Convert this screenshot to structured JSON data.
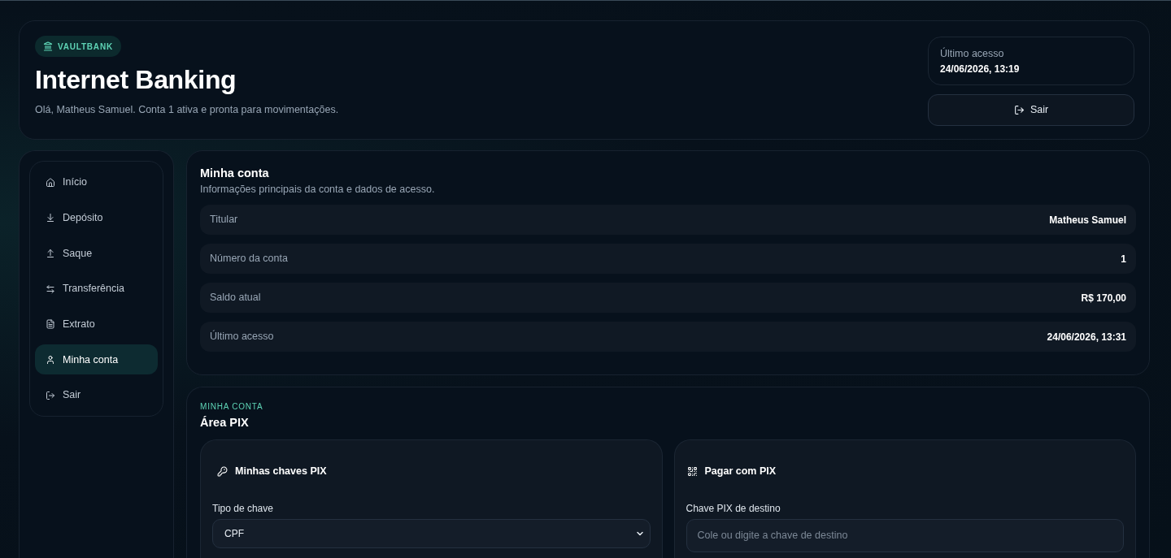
{
  "header": {
    "brand": "VAULTBANK",
    "title": "Internet Banking",
    "greeting": "Olá, Matheus Samuel. Conta 1 ativa e pronta para movimentações.",
    "last_access": {
      "label": "Último acesso",
      "value": "24/06/2026, 13:19"
    },
    "logout_button": "Sair"
  },
  "sidebar": {
    "items": [
      {
        "label": "Início",
        "selected": false
      },
      {
        "label": "Depósito",
        "selected": false
      },
      {
        "label": "Saque",
        "selected": false
      },
      {
        "label": "Transferência",
        "selected": false
      },
      {
        "label": "Extrato",
        "selected": false
      },
      {
        "label": "Minha conta",
        "selected": true
      },
      {
        "label": "Sair",
        "selected": false
      }
    ]
  },
  "account": {
    "title": "Minha conta",
    "subtitle": "Informações principais da conta e dados de acesso.",
    "rows": [
      {
        "label": "Titular",
        "value": "Matheus Samuel"
      },
      {
        "label": "Número da conta",
        "value": "1"
      },
      {
        "label": "Saldo atual",
        "value": "R$ 170,00"
      },
      {
        "label": "Último acesso",
        "value": "24/06/2026, 13:31"
      }
    ]
  },
  "pix": {
    "eyebrow": "MINHA CONTA",
    "title": "Área PIX",
    "my_keys": {
      "title": "Minhas chaves PIX",
      "key_type": {
        "label": "Tipo de chave",
        "value": "CPF"
      }
    },
    "pay": {
      "title": "Pagar com PIX",
      "destination": {
        "label": "Chave PIX de destino",
        "placeholder": "Cole ou digite a chave de destino"
      }
    }
  }
}
